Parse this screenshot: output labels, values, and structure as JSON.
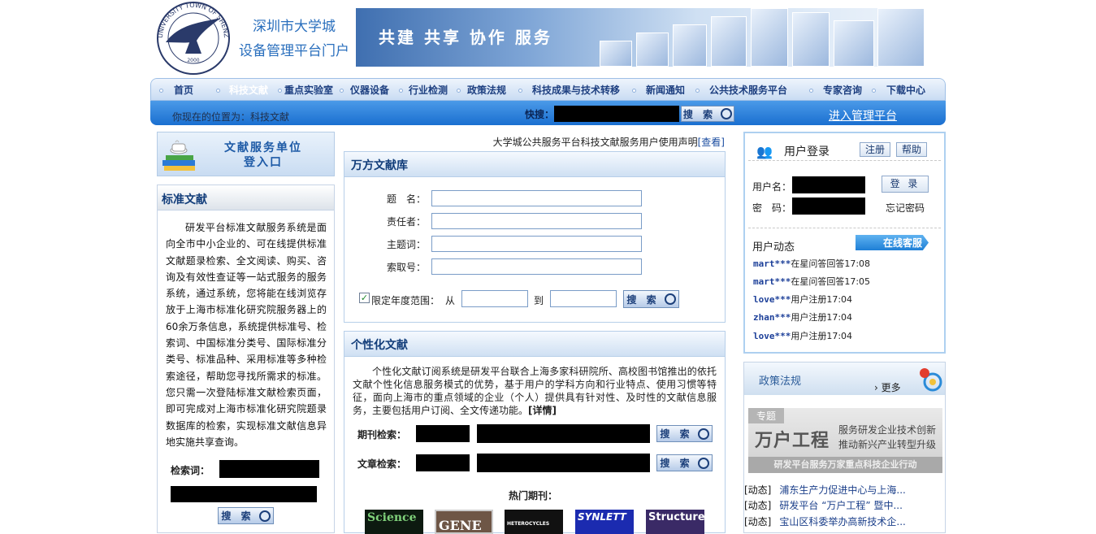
{
  "header": {
    "logo_text": "UNIVERSITY TOWN OF SHENZHEN 深圳大学城 2000",
    "site_title_line1": "深圳市大学城",
    "site_title_line2": "设备管理平台门户",
    "banner_slogan": "共建 共享 协作 服务"
  },
  "nav": {
    "items": [
      "首页",
      "科技文献",
      "重点实验室",
      "仪器设备",
      "行业检测",
      "政策法规",
      "科技成果与技术转移",
      "新闻通知",
      "公共技术服务平台",
      "专家咨询",
      "下载中心"
    ],
    "location": "你现在的位置为：科技文献",
    "quick_label": "快搜：",
    "search_label": "搜 索",
    "admin_link": "进入管理平台"
  },
  "left": {
    "entry_line1": "文献服务单位",
    "entry_line2": "登入口",
    "std_title": "标准文献",
    "std_text": "研发平台标准文献服务系统是面向全市中小企业的、可在线提供标准文献题录检索、全文阅读、购买、咨询及有效性查证等一站式服务的服务系统，通过系统，您将能在线浏览存放于上海市标准化研究院服务器上的60余万条信息，系统提供标准号、检索词、中国标准分类号、国际标准分类号、标准品种、采用标准等多种检索途径，帮助您寻找所需求的标准。您只需一次登陆标准文献检索页面，即可完成对上海市标准化研究院题录数据库的检索，实现标准文献信息异地实施共享查询。",
    "keyword_label": "检索词：",
    "search_label": "搜 索"
  },
  "middle": {
    "declaration": "大学城公共服务平台科技文献服务用户使用声明",
    "declaration_link": "[查看]",
    "wanfang_title": "万方文献库",
    "field_title": "题　名：",
    "field_author": "责任者：",
    "field_subject": "主题词：",
    "field_callno": "索取号：",
    "year_range_label": "限定年度范围：",
    "from_label": "从",
    "to_label": "到",
    "search_label": "搜 索",
    "personal_title": "个性化文献",
    "personal_text": "个性化文献订阅系统是研发平台联合上海多家科研院所、高校图书馆推出的依托文献个性化信息服务模式的优势，基于用户的学科方向和行业特点、使用习惯等特征，面向上海市的重点领域的企业（个人）提供具有针对性、及时性的文献信息服务，主要包括用户订阅、全文传递功能。",
    "personal_more": "[详情]",
    "journal_search_label": "期刊检索：",
    "article_search_label": "文章检索：",
    "hot_journals_label": "热门期刊：",
    "covers": [
      "Science",
      "GENE",
      "HETEROCYCLES",
      "SYNLETT",
      "Structure"
    ]
  },
  "right": {
    "login_title": "用户登录",
    "register_label": "注册",
    "help_label": "帮助",
    "username_label": "用户名：",
    "password_label": "密　码：",
    "login_button": "登 录",
    "forgot_password": "忘记密码",
    "activity_title": "用户动态",
    "online_service": "在线客服",
    "activities": [
      {
        "user": "mart***",
        "text": "在星问答回答17:08"
      },
      {
        "user": "mart***",
        "text": "在星问答回答17:05"
      },
      {
        "user": "love***",
        "text": "用户注册17:04"
      },
      {
        "user": "zhan***",
        "text": "用户注册17:04"
      },
      {
        "user": "love***",
        "text": "用户注册17:04"
      }
    ],
    "policy_title": "政策法规",
    "policy_more": "更多",
    "promo_topic": "专题",
    "promo_big": "万户工程",
    "promo_line1": "服务研发企业技术创新",
    "promo_line2": "推动新兴产业转型升级",
    "promo_footer": "研发平台服务万家重点科技企业行动",
    "news": [
      {
        "tag": "[动态]",
        "title": "浦东生产力促进中心与上海..."
      },
      {
        "tag": "[动态]",
        "title": "研发平台 “万户工程” 暨中..."
      },
      {
        "tag": "[动态]",
        "title": "宝山区科委举办高新技术企..."
      }
    ]
  },
  "colors": {
    "nav_blue": "#1a6fd0",
    "title_blue": "#2a6fbd",
    "heading_blue": "#123d7a"
  }
}
